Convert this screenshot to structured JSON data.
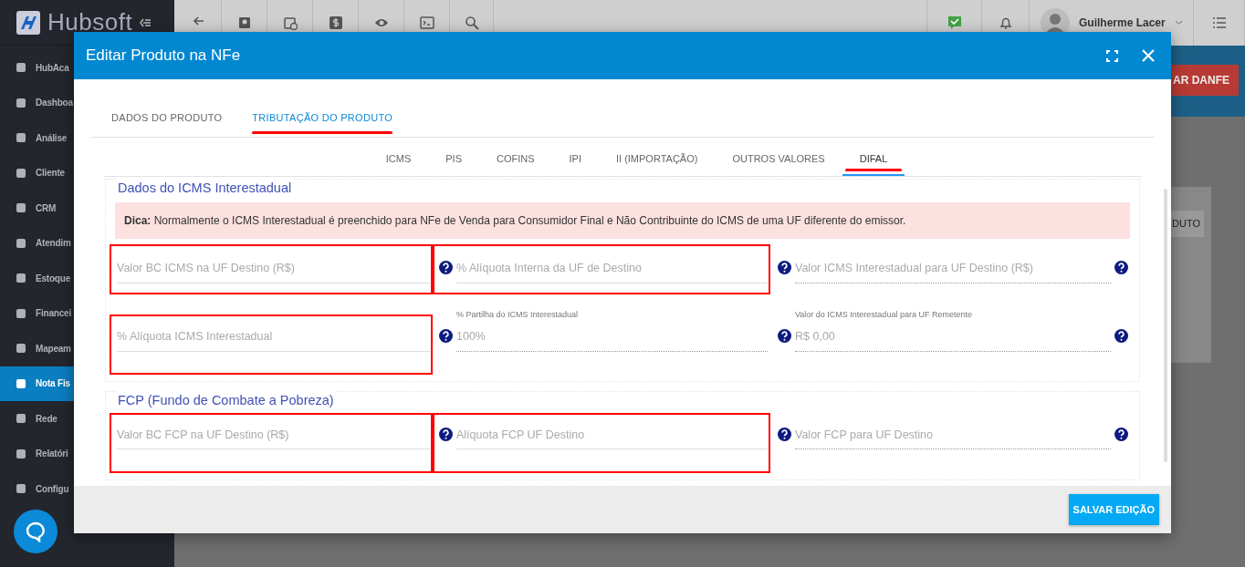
{
  "app": {
    "logo": "Hubsoft",
    "sidebar": {
      "items": [
        {
          "label": "HubAca",
          "selected": false
        },
        {
          "label": "Dashboa",
          "selected": false
        },
        {
          "label": "Análise",
          "selected": false
        },
        {
          "label": "Cliente",
          "selected": false
        },
        {
          "label": "CRM",
          "selected": false
        },
        {
          "label": "Atendim",
          "selected": false
        },
        {
          "label": "Estoque",
          "selected": false
        },
        {
          "label": "Financei",
          "selected": false
        },
        {
          "label": "Mapeam",
          "selected": false
        },
        {
          "label": "Nota Fis",
          "selected": true
        },
        {
          "label": "Rede",
          "selected": false
        },
        {
          "label": "Relatóri",
          "selected": false
        },
        {
          "label": "Configu",
          "selected": false
        }
      ]
    },
    "user": {
      "name": "Guilherme Lacer"
    },
    "background_buttons": [
      "AR DANFE",
      "DUTO"
    ]
  },
  "modal": {
    "title": "Editar Produto na NFe",
    "tabs": [
      {
        "label": "DADOS DO PRODUTO",
        "selected": false,
        "annotated": false
      },
      {
        "label": "TRIBUTAÇÃO DO PRODUTO",
        "selected": true,
        "annotated": true
      }
    ],
    "subtabs": [
      {
        "label": "ICMS",
        "selected": false,
        "annotated": false
      },
      {
        "label": "PIS",
        "selected": false,
        "annotated": false
      },
      {
        "label": "COFINS",
        "selected": false,
        "annotated": false
      },
      {
        "label": "IPI",
        "selected": false,
        "annotated": false
      },
      {
        "label": "II (IMPORTAÇÃO)",
        "selected": false,
        "annotated": false
      },
      {
        "label": "OUTROS VALORES",
        "selected": false,
        "annotated": false
      },
      {
        "label": "DIFAL",
        "selected": true,
        "annotated": true
      }
    ],
    "sections": [
      {
        "title": "Dados do ICMS Interestadual",
        "tip": "**Dica:** Normalmente o ICMS Interestadual é preenchido para NFe de Venda para Consumidor Final e Não Contribuinte do ICMS de uma UF diferente do emissor.",
        "rows": [
          [
            {
              "placeholder": "Valor BC ICMS na UF Destino (R$)",
              "disabled": false,
              "highlighted": true
            },
            {
              "placeholder": "% Alíquota Interna da UF de Destino",
              "disabled": false,
              "highlighted": true
            },
            {
              "placeholder": "Valor ICMS Interestadual para UF Destino (R$)",
              "disabled": true,
              "highlighted": false
            }
          ],
          [
            {
              "placeholder": "% Alíquota ICMS Interestadual",
              "disabled": false,
              "highlighted": true
            },
            {
              "label": "% Partilha do ICMS Interestadual",
              "value": "100%",
              "disabled": true,
              "highlighted": false
            },
            {
              "label": "Valor do ICMS Interestadual para UF Remetente",
              "value": "R$ 0,00",
              "disabled": true,
              "highlighted": false
            }
          ]
        ]
      },
      {
        "title": "FCP (Fundo de Combate a Pobreza)",
        "rows": [
          [
            {
              "placeholder": "Valor BC FCP na UF Destino (R$)",
              "disabled": false,
              "highlighted": true
            },
            {
              "placeholder": "Alíquota FCP UF Destino",
              "disabled": false,
              "highlighted": true
            },
            {
              "placeholder": "Valor FCP para UF Destino",
              "disabled": true,
              "highlighted": false
            }
          ]
        ]
      }
    ],
    "save_button": "SALVAR EDIÇÃO"
  }
}
